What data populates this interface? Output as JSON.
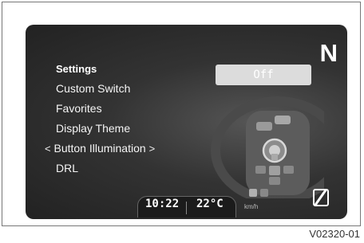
{
  "display": {
    "gear": "N",
    "settings_title": "Settings",
    "menu_items": [
      {
        "label": "Custom Switch"
      },
      {
        "label": "Favorites"
      },
      {
        "label": "Display Theme"
      },
      {
        "label": "Button Illumination",
        "selected": true
      },
      {
        "label": "DRL"
      }
    ],
    "left_arrow": "<",
    "right_arrow": ">",
    "value_label": "Off",
    "time": "10:22",
    "temperature": "22°C",
    "speed_unit": "km/h"
  },
  "figure_code": "V02320-01",
  "colors": {
    "screen_bg": "#2b2b2b",
    "text": "#ffffff",
    "value_pill": "#dcdcdc"
  },
  "icons": [
    "steering-wheel-controls-illustration",
    "speed-limit-off-icon"
  ]
}
